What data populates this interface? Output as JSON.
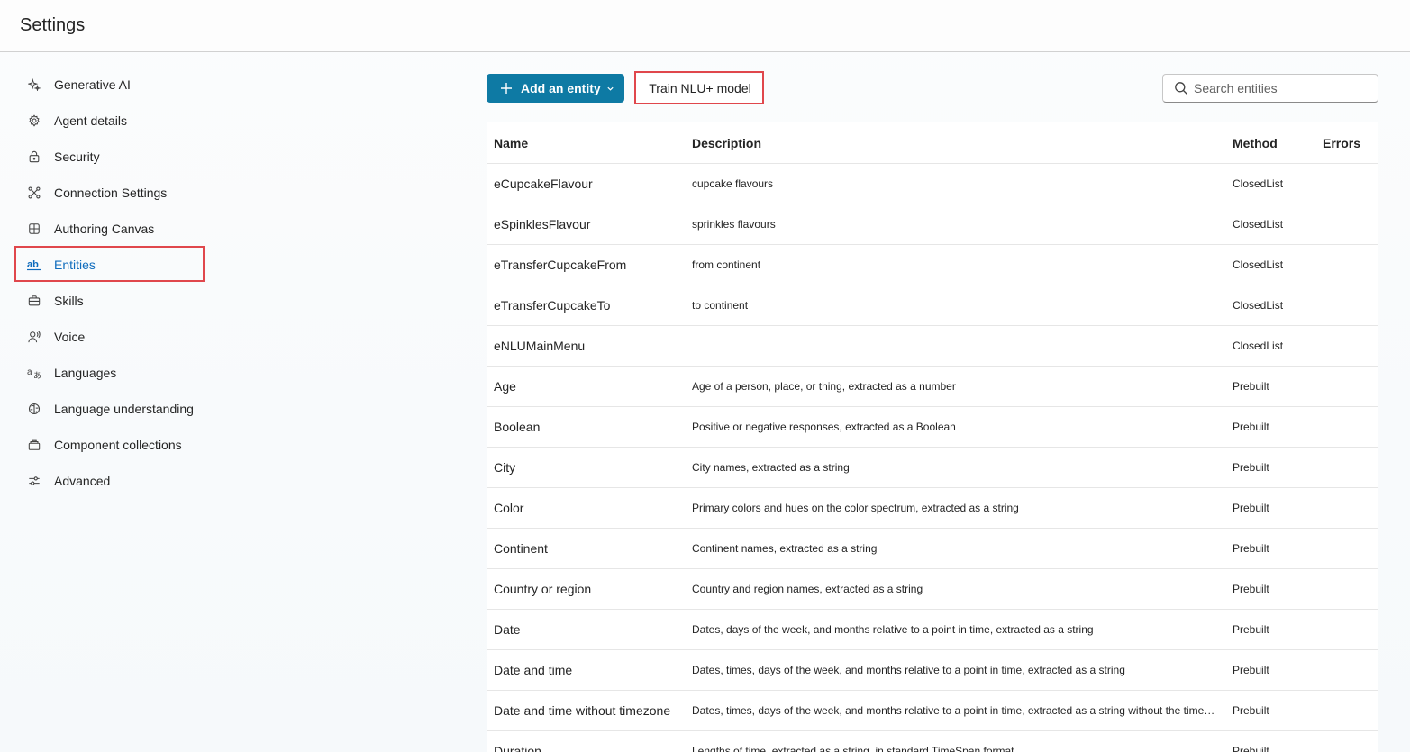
{
  "header": {
    "title": "Settings"
  },
  "sidebar": {
    "items": [
      {
        "label": "Generative AI",
        "icon": "sparkle-icon",
        "active": false
      },
      {
        "label": "Agent details",
        "icon": "gear-icon",
        "active": false
      },
      {
        "label": "Security",
        "icon": "lock-icon",
        "active": false
      },
      {
        "label": "Connection Settings",
        "icon": "connection-icon",
        "active": false
      },
      {
        "label": "Authoring Canvas",
        "icon": "grid-icon",
        "active": false
      },
      {
        "label": "Entities",
        "icon": "entities-ab-icon",
        "active": true
      },
      {
        "label": "Skills",
        "icon": "briefcase-icon",
        "active": false
      },
      {
        "label": "Voice",
        "icon": "voice-icon",
        "active": false
      },
      {
        "label": "Languages",
        "icon": "languages-icon",
        "active": false
      },
      {
        "label": "Language understanding",
        "icon": "brain-icon",
        "active": false
      },
      {
        "label": "Component collections",
        "icon": "collection-icon",
        "active": false
      },
      {
        "label": "Advanced",
        "icon": "sliders-icon",
        "active": false
      }
    ]
  },
  "toolbar": {
    "add_label": "Add an entity",
    "train_label": "Train NLU+ model",
    "search_placeholder": "Search entities"
  },
  "table": {
    "columns": {
      "name": "Name",
      "description": "Description",
      "method": "Method",
      "errors": "Errors"
    },
    "rows": [
      {
        "name": "eCupcakeFlavour",
        "description": "cupcake flavours",
        "method": "ClosedList"
      },
      {
        "name": "eSpinklesFlavour",
        "description": "sprinkles flavours",
        "method": "ClosedList"
      },
      {
        "name": "eTransferCupcakeFrom",
        "description": "from continent",
        "method": "ClosedList"
      },
      {
        "name": "eTransferCupcakeTo",
        "description": "to continent",
        "method": "ClosedList"
      },
      {
        "name": "eNLUMainMenu",
        "description": "",
        "method": "ClosedList"
      },
      {
        "name": "Age",
        "description": "Age of a person, place, or thing, extracted as a number",
        "method": "Prebuilt"
      },
      {
        "name": "Boolean",
        "description": "Positive or negative responses, extracted as a Boolean",
        "method": "Prebuilt"
      },
      {
        "name": "City",
        "description": "City names, extracted as a string",
        "method": "Prebuilt"
      },
      {
        "name": "Color",
        "description": "Primary colors and hues on the color spectrum, extracted as a string",
        "method": "Prebuilt"
      },
      {
        "name": "Continent",
        "description": "Continent names, extracted as a string",
        "method": "Prebuilt"
      },
      {
        "name": "Country or region",
        "description": "Country and region names, extracted as a string",
        "method": "Prebuilt"
      },
      {
        "name": "Date",
        "description": "Dates, days of the week, and months relative to a point in time, extracted as a string",
        "method": "Prebuilt"
      },
      {
        "name": "Date and time",
        "description": "Dates, times, days of the week, and months relative to a point in time, extracted as a string",
        "method": "Prebuilt"
      },
      {
        "name": "Date and time without timezone",
        "description": "Dates, times, days of the week, and months relative to a point in time, extracted as a string without the timez...",
        "method": "Prebuilt"
      },
      {
        "name": "Duration",
        "description": "Lengths of time, extracted as a string, in standard TimeSpan format",
        "method": "Prebuilt"
      }
    ]
  },
  "colors": {
    "accent": "#0e7aa4",
    "active_nav": "#0f6cbd",
    "highlight": "#e0474c"
  }
}
